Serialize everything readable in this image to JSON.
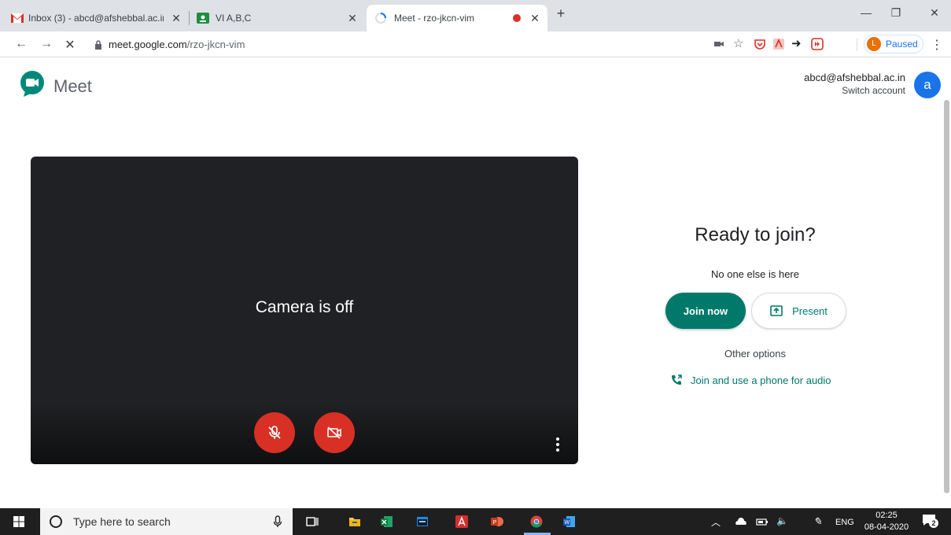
{
  "browser": {
    "tabs": [
      {
        "label": "Inbox (3) - abcd@afshebbal.ac.in",
        "icon": "gmail-icon"
      },
      {
        "label": "VI A,B,C",
        "icon": "classroom-icon"
      },
      {
        "label": "Meet - rzo-jkcn-vim",
        "icon": "loading-icon",
        "active": true
      }
    ],
    "new_tab": "+",
    "url_host": "meet.google.com",
    "url_path": "/rzo-jkcn-vim",
    "profile_initial": "L",
    "profile_status": "Paused",
    "colors": {
      "tabstrip": "#dee1e6",
      "accent": "#1a73e8",
      "profile": "#e8710a"
    }
  },
  "meet": {
    "app_name": "Meet",
    "account_email": "abcd@afshebbal.ac.in",
    "switch_account": "Switch account",
    "avatar_initial": "a",
    "camera_status": "Camera is off",
    "ready_title": "Ready to join?",
    "participants_note": "No one else is here",
    "join_label": "Join now",
    "present_label": "Present",
    "other_options": "Other options",
    "phone_audio": "Join and use a phone for audio",
    "colors": {
      "primary": "#00796b",
      "danger": "#d93025",
      "video_bg": "#202124"
    }
  },
  "taskbar": {
    "search_placeholder": "Type here to search",
    "language": "ENG",
    "time": "02:25",
    "date": "08-04-2020",
    "notifications": "2"
  }
}
